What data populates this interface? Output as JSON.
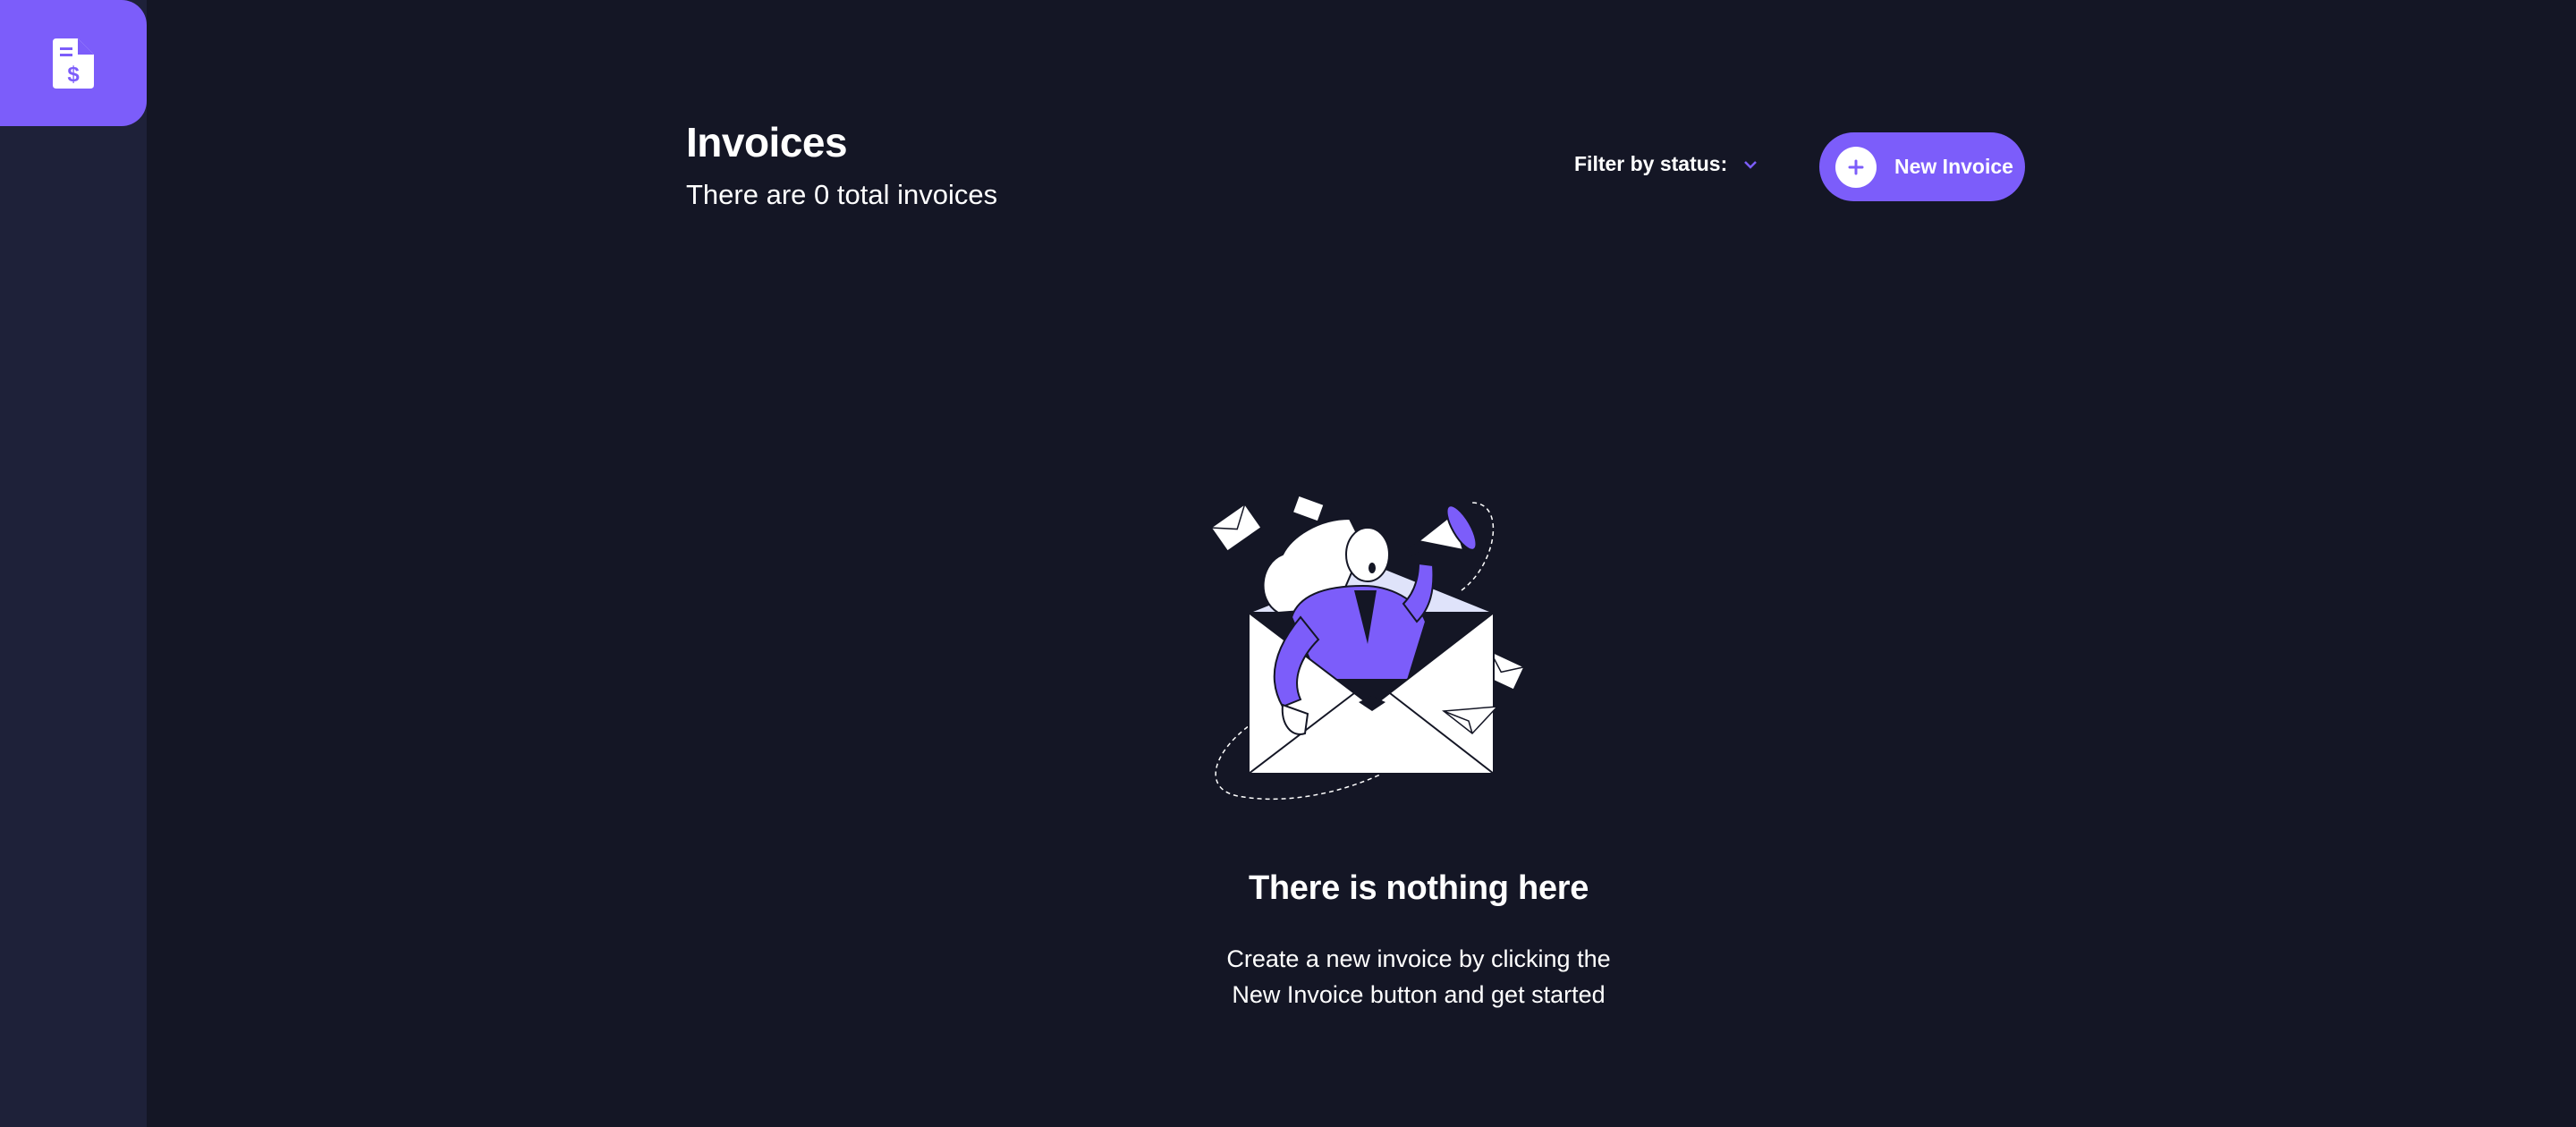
{
  "header": {
    "title": "Invoices",
    "subtitle": "There are 0 total invoices",
    "filter_label": "Filter by status:",
    "new_invoice_label": "New Invoice"
  },
  "empty_state": {
    "title": "There is nothing here",
    "text": "Create a new invoice by clicking the New Invoice button and get started"
  },
  "icons": {
    "logo": "invoice-dollar-icon",
    "filter": "chevron-down-icon",
    "add": "plus-icon"
  },
  "colors": {
    "accent": "#7c5dfa",
    "background": "#141625",
    "sidebar": "#1e2139"
  }
}
